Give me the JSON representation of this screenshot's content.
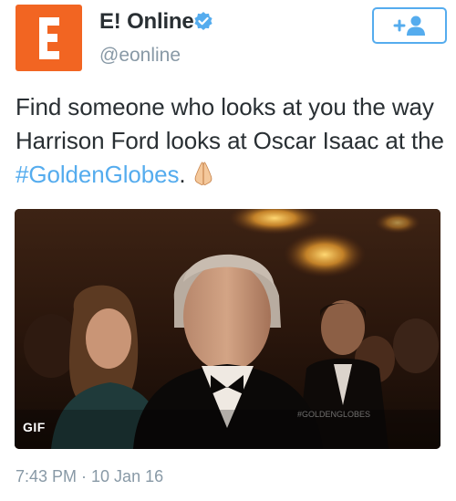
{
  "account": {
    "display_name": "E! Online",
    "screen_name": "@eonline",
    "verified": true,
    "avatar_icon": "e-online-logo-icon",
    "brand_color": "#f26522"
  },
  "follow_button": {
    "icon": "follow-user-icon",
    "accent_color": "#55acee"
  },
  "tweet": {
    "text_before": "Find someone who looks at you the way Harrison Ford looks at Oscar Isaac at the ",
    "hashtag": "#GoldenGlobes",
    "text_after": ".",
    "emoji": "folded-hands-icon"
  },
  "media": {
    "type_badge": "GIF",
    "watermark": "#GOLDENGLOBES"
  },
  "meta": {
    "timestamp": "7:43 PM · 10 Jan 16"
  }
}
